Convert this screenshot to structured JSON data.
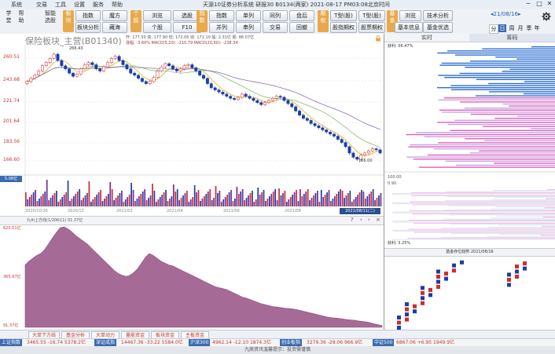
{
  "menu": {
    "items": [
      "系统",
      "交易",
      "工具",
      "设置",
      "服务",
      "帮助"
    ],
    "title": "天源10证券分析系统  研报30 B0134(两家) 2021-08-17 PM03:08北京时间",
    "win_buttons": [
      "─",
      "□",
      "✕"
    ]
  },
  "toolbar": {
    "left_tall": [
      {
        "label": "学\n堂",
        "id": "xuetang"
      },
      {
        "label": "帮\n助",
        "id": "bangzhu"
      }
    ],
    "zhineng": "智能\n选股",
    "groups": [
      {
        "category": "板\n块",
        "buttons": [
          "指数",
          "魔方",
          "板块分析",
          "藏海"
        ]
      },
      {
        "category": "个\n股",
        "buttons": [
          "浏览",
          "选股",
          "个股",
          "F10"
        ]
      },
      {
        "category": "指\n数",
        "buttons": [
          "指数",
          "单列",
          "同列",
          "盘后",
          "并列",
          "串列",
          "交易",
          "回撤"
        ]
      },
      {
        "category": "期\n权",
        "buttons": [
          "T型(股)",
          "T型(股)",
          "股指期权",
          "股票期权"
        ]
      },
      {
        "category": "基\n金",
        "buttons": [
          "浏览",
          "技术分析",
          "基本信息",
          "基金优选"
        ]
      }
    ],
    "date_picker": "◂21/08/16▸",
    "periods": [
      "分",
      "日",
      "周",
      "月",
      "季",
      "年"
    ],
    "settings_icon": "gear-icon"
  },
  "main_chart": {
    "title": "保险板块_主营(B01340)",
    "info_line1": "开: 177.50 高: 177.90 低: 172.05 收: 172.10 幅: 2.31亿 振: 86.07亿",
    "info_line2": "涨幅: -3.60% MACD(5,20): -210.79 MACD(20,60): -238.34",
    "y_ticks": [
      "260.51",
      "243.68",
      "221.74",
      "201.64",
      "183.56",
      "166.60"
    ],
    "peak_label": "266.43",
    "low_label": "166.00",
    "volume_label": "5.08亿",
    "x_labels": [
      "2020/10/26",
      "2020/12",
      "2021/02",
      "2021/04",
      "2021/06",
      "2021/08"
    ],
    "date_box": "2021/08/11(二)"
  },
  "lower_chart": {
    "title": "九州上方线(1/206)(1) 01.37亿",
    "y_ticks": [
      "620.51亿",
      "365.97亿",
      "91.37亿"
    ]
  },
  "right_panel": {
    "tabs": [
      "实时",
      "筹码"
    ],
    "top_label": "获利: 06.47%",
    "mid_label1": "100.00",
    "mid_label2": "0.90",
    "bottom_label": "获利: 3.25%",
    "bottom_title": "基金存位趋势 2021/08/16"
  },
  "bottom_tabs": [
    "大单下方线",
    "基金分析",
    "大单动力",
    "量能资金",
    "板块资金",
    "主板资金"
  ],
  "status": [
    {
      "name": "上证指数",
      "value": "3465.55  -16.74  5378.2亿"
    },
    {
      "name": "深证成指",
      "value": "14467.36  -33.22  5584.0亿"
    },
    {
      "name": "沪深300",
      "value": "4962.14  -12.10  1874.3亿"
    },
    {
      "name": "创业板指",
      "value": "3279.36  -29.06  966.9亿"
    },
    {
      "name": "中证500",
      "value": "6867.06  +6.95  1949.9亿"
    }
  ],
  "footer": "九辰资讯温馨提示：投资需谨慎",
  "chart_data": [
    {
      "type": "candlestick",
      "title": "保险板块_主营(B01340)",
      "x_range": [
        "2020/10/26",
        "2021/08/11"
      ],
      "ylim": [
        160,
        275
      ],
      "series": [
        {
          "name": "close",
          "values": [
            240,
            243,
            246,
            250,
            255,
            258,
            262,
            266,
            260,
            255,
            252,
            248,
            245,
            247,
            252,
            256,
            258,
            256,
            252,
            250,
            254,
            258,
            262,
            264,
            260,
            256,
            252,
            248,
            246,
            243,
            240,
            238,
            240,
            244,
            250,
            254,
            257,
            255,
            252,
            250,
            252,
            255,
            256,
            253,
            250,
            246,
            243,
            238,
            234,
            232,
            230,
            228,
            226,
            224,
            223,
            225,
            228,
            226,
            224,
            222,
            220,
            218,
            220,
            222,
            224,
            226,
            225,
            222,
            219,
            216,
            212,
            208,
            205,
            203,
            200,
            198,
            196,
            194,
            192,
            190,
            188,
            185,
            182,
            178,
            172,
            168,
            166,
            170,
            172,
            174,
            176,
            175,
            172
          ]
        }
      ]
    },
    {
      "type": "area",
      "title": "九州上方线(1/206)(1) 01.37亿",
      "ylim": [
        91.37,
        620.51
      ],
      "series": [
        {
          "name": "九州上方线",
          "values": [
            420,
            440,
            455,
            470,
            480,
            500,
            530,
            560,
            590,
            615,
            620,
            610,
            595,
            575,
            560,
            545,
            530,
            510,
            490,
            470,
            450,
            430,
            410,
            390,
            375,
            365,
            360,
            365,
            380,
            400,
            430,
            460,
            480,
            470,
            455,
            440,
            430,
            420,
            415,
            405,
            395,
            385,
            375,
            365,
            355,
            345,
            335,
            325,
            315,
            305,
            300,
            295,
            290,
            280,
            270,
            260,
            250,
            245,
            238,
            230,
            222,
            215,
            210,
            205,
            200,
            198,
            195,
            192,
            190,
            188,
            185,
            180,
            175,
            170,
            165,
            160,
            155,
            150,
            145,
            142,
            140,
            138,
            135,
            132,
            130,
            128,
            125,
            122,
            120,
            115,
            110,
            105,
            100
          ]
        }
      ]
    }
  ]
}
